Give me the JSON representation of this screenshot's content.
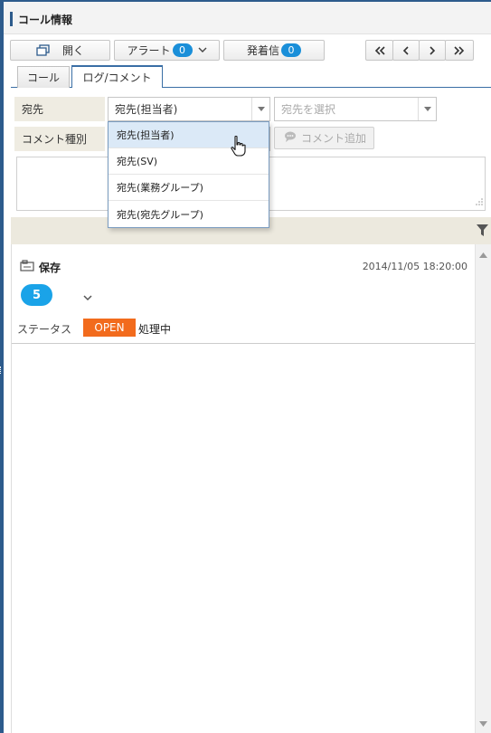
{
  "header": {
    "title": "コール情報"
  },
  "toolbar": {
    "open_label": "開く",
    "alert_label": "アラート",
    "alert_count": "0",
    "outgoing_label": "発着信",
    "outgoing_count": "0"
  },
  "tabs": [
    {
      "label": "コール",
      "active": false
    },
    {
      "label": "ログ/コメント",
      "active": true
    }
  ],
  "form": {
    "destination_label": "宛先",
    "destination_value": "宛先(担当者)",
    "destination_select_placeholder": "宛先を選択",
    "comment_type_label": "コメント種別",
    "add_comment_label": "コメント追加"
  },
  "dropdown": {
    "options": [
      "宛先(担当者)",
      "宛先(SV)",
      "宛先(業務グループ)",
      "宛先(宛先グループ)"
    ],
    "hovered_index": 0
  },
  "log_entry": {
    "title": "保存",
    "timestamp": "2014/11/05 18:20:00",
    "count": "5",
    "status_label": "ステータス",
    "status_badge": "OPEN",
    "status_text": "処理中"
  },
  "colors": {
    "accent": "#2d5b8c",
    "badge_blue": "#1a8fd9",
    "count_blue": "#1aa3e8",
    "status_orange": "#f26b1d",
    "label_bg": "#efece2"
  }
}
